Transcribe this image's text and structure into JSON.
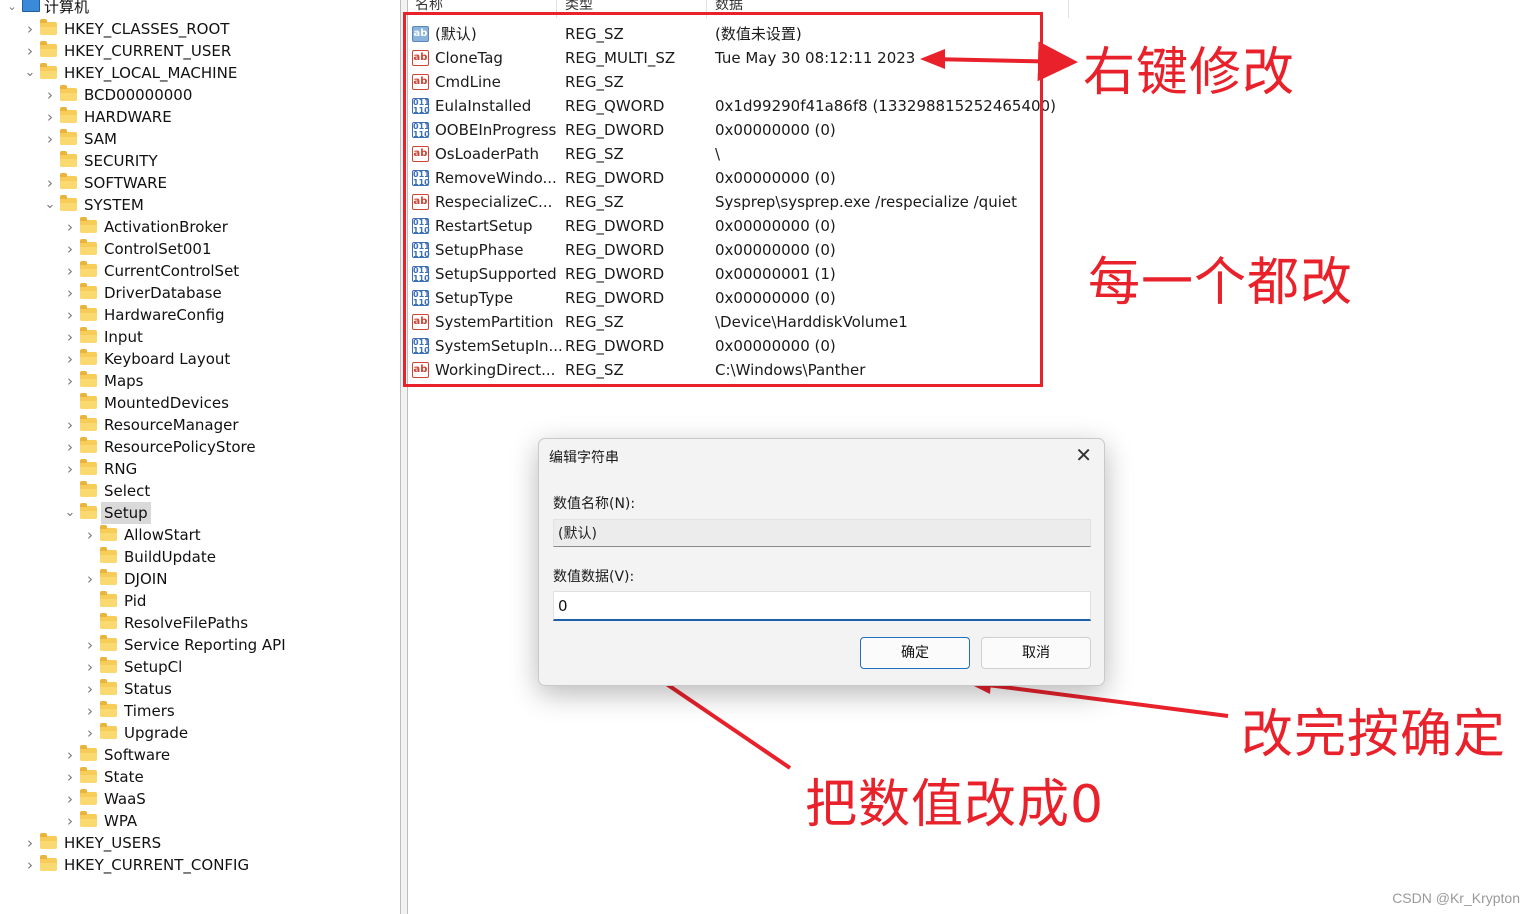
{
  "tree": {
    "root": "计算机",
    "items": [
      {
        "label": "HKEY_CLASSES_ROOT",
        "chevron": "right"
      },
      {
        "label": "HKEY_CURRENT_USER",
        "chevron": "right"
      },
      {
        "label": "HKEY_LOCAL_MACHINE",
        "chevron": "down"
      },
      {
        "label": "BCD00000000",
        "chevron": "right"
      },
      {
        "label": "HARDWARE",
        "chevron": "right"
      },
      {
        "label": "SAM",
        "chevron": "right"
      },
      {
        "label": "SECURITY",
        "chevron": ""
      },
      {
        "label": "SOFTWARE",
        "chevron": "right"
      },
      {
        "label": "SYSTEM",
        "chevron": "down"
      },
      {
        "label": "ActivationBroker",
        "chevron": "right"
      },
      {
        "label": "ControlSet001",
        "chevron": "right"
      },
      {
        "label": "CurrentControlSet",
        "chevron": "right"
      },
      {
        "label": "DriverDatabase",
        "chevron": "right"
      },
      {
        "label": "HardwareConfig",
        "chevron": "right"
      },
      {
        "label": "Input",
        "chevron": "right"
      },
      {
        "label": "Keyboard Layout",
        "chevron": "right"
      },
      {
        "label": "Maps",
        "chevron": "right"
      },
      {
        "label": "MountedDevices",
        "chevron": ""
      },
      {
        "label": "ResourceManager",
        "chevron": "right"
      },
      {
        "label": "ResourcePolicyStore",
        "chevron": "right"
      },
      {
        "label": "RNG",
        "chevron": "right"
      },
      {
        "label": "Select",
        "chevron": ""
      },
      {
        "label": "Setup",
        "chevron": "down"
      },
      {
        "label": "AllowStart",
        "chevron": "right"
      },
      {
        "label": "BuildUpdate",
        "chevron": ""
      },
      {
        "label": "DJOIN",
        "chevron": "right"
      },
      {
        "label": "Pid",
        "chevron": ""
      },
      {
        "label": "ResolveFilePaths",
        "chevron": ""
      },
      {
        "label": "Service Reporting API",
        "chevron": "right"
      },
      {
        "label": "SetupCl",
        "chevron": "right"
      },
      {
        "label": "Status",
        "chevron": "right"
      },
      {
        "label": "Timers",
        "chevron": "right"
      },
      {
        "label": "Upgrade",
        "chevron": "right"
      },
      {
        "label": "Software",
        "chevron": "right"
      },
      {
        "label": "State",
        "chevron": "right"
      },
      {
        "label": "WaaS",
        "chevron": "right"
      },
      {
        "label": "WPA",
        "chevron": "right"
      },
      {
        "label": "HKEY_USERS",
        "chevron": "right"
      },
      {
        "label": "HKEY_CURRENT_CONFIG",
        "chevron": "right"
      }
    ],
    "selected": "Setup"
  },
  "columns": {
    "name": "名称",
    "type": "类型",
    "data": "数据"
  },
  "values": [
    {
      "icon": "string-default-icon",
      "kind": "ab",
      "name": "(默认)",
      "type": "REG_SZ",
      "data": "(数值未设置)"
    },
    {
      "icon": "string-value-icon",
      "kind": "ab",
      "name": "CloneTag",
      "type": "REG_MULTI_SZ",
      "data": "Tue May 30 08:12:11 2023"
    },
    {
      "icon": "string-value-icon",
      "kind": "ab",
      "name": "CmdLine",
      "type": "REG_SZ",
      "data": ""
    },
    {
      "icon": "binary-value-icon",
      "kind": "bin",
      "name": "EulaInstalled",
      "type": "REG_QWORD",
      "data": "0x1d99290f41a86f8 (133298815252465400)"
    },
    {
      "icon": "binary-value-icon",
      "kind": "bin",
      "name": "OOBEInProgress",
      "type": "REG_DWORD",
      "data": "0x00000000 (0)"
    },
    {
      "icon": "string-value-icon",
      "kind": "ab",
      "name": "OsLoaderPath",
      "type": "REG_SZ",
      "data": "\\"
    },
    {
      "icon": "binary-value-icon",
      "kind": "bin",
      "name": "RemoveWindo...",
      "type": "REG_DWORD",
      "data": "0x00000000 (0)"
    },
    {
      "icon": "string-value-icon",
      "kind": "ab",
      "name": "RespecializeC...",
      "type": "REG_SZ",
      "data": "Sysprep\\sysprep.exe /respecialize /quiet"
    },
    {
      "icon": "binary-value-icon",
      "kind": "bin",
      "name": "RestartSetup",
      "type": "REG_DWORD",
      "data": "0x00000000 (0)"
    },
    {
      "icon": "binary-value-icon",
      "kind": "bin",
      "name": "SetupPhase",
      "type": "REG_DWORD",
      "data": "0x00000000 (0)"
    },
    {
      "icon": "binary-value-icon",
      "kind": "bin",
      "name": "SetupSupported",
      "type": "REG_DWORD",
      "data": "0x00000001 (1)"
    },
    {
      "icon": "binary-value-icon",
      "kind": "bin",
      "name": "SetupType",
      "type": "REG_DWORD",
      "data": "0x00000000 (0)"
    },
    {
      "icon": "string-value-icon",
      "kind": "ab",
      "name": "SystemPartition",
      "type": "REG_SZ",
      "data": "\\Device\\HarddiskVolume1"
    },
    {
      "icon": "binary-value-icon",
      "kind": "bin",
      "name": "SystemSetupIn...",
      "type": "REG_DWORD",
      "data": "0x00000000 (0)"
    },
    {
      "icon": "string-value-icon",
      "kind": "ab",
      "name": "WorkingDirect...",
      "type": "REG_SZ",
      "data": "C:\\Windows\\Panther"
    }
  ],
  "annotations": {
    "right_click": "右键修改",
    "change_all": "每一个都改",
    "press_ok": "改完按确定",
    "set_zero": "把数值改成0",
    "color": "#e8212b"
  },
  "dialog": {
    "title": "编辑字符串",
    "name_label": "数值名称(N):",
    "name_value": "(默认)",
    "data_label": "数值数据(V):",
    "data_value": "0",
    "ok": "确定",
    "cancel": "取消"
  },
  "watermark": "CSDN @Kr_Krypton"
}
